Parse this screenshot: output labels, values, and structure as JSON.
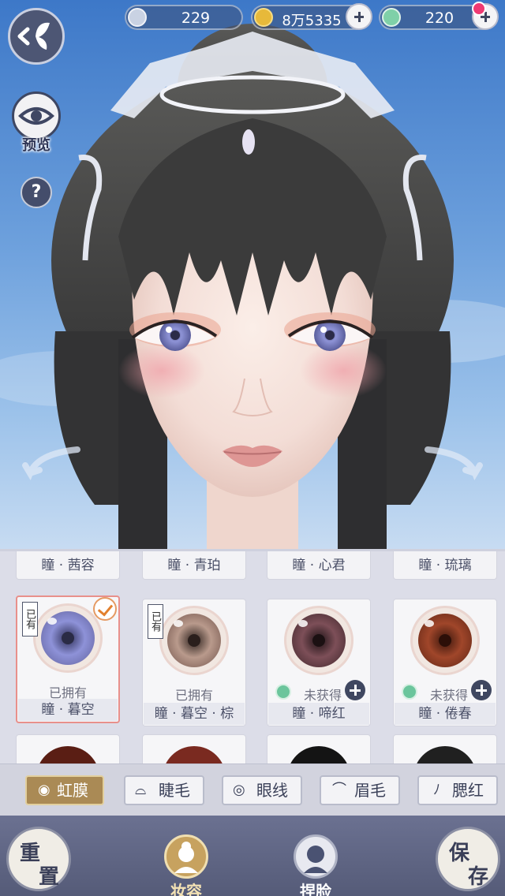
{
  "currency": {
    "silver": "229",
    "coins": "8万5335",
    "jade": "220"
  },
  "left": {
    "preview_label": "预览",
    "help_label": "?"
  },
  "panel": {
    "top_row": [
      "瞳 · 茜容",
      "瞳 · 青珀",
      "瞳 · 心君",
      "瞳 · 琉璃"
    ],
    "items": [
      {
        "name": "瞳 · 暮空",
        "status": "已拥有",
        "owned_tag": "已有",
        "selected": true,
        "locked": false
      },
      {
        "name": "瞳 · 暮空 · 棕",
        "status": "已拥有",
        "owned_tag": "已有",
        "selected": false,
        "locked": false
      },
      {
        "name": "瞳 · 啼红",
        "status": "未获得",
        "owned_tag": "",
        "selected": false,
        "locked": true
      },
      {
        "name": "瞳 · 倦春",
        "status": "未获得",
        "owned_tag": "",
        "selected": false,
        "locked": true
      }
    ]
  },
  "tabs": [
    {
      "label": "虹膜",
      "icon": "iris-icon"
    },
    {
      "label": "睫毛",
      "icon": "eyelash-icon"
    },
    {
      "label": "眼线",
      "icon": "eyeliner-icon"
    },
    {
      "label": "眉毛",
      "icon": "eyebrow-icon"
    },
    {
      "label": "腮红",
      "icon": "blush-icon"
    }
  ],
  "bottom": {
    "reset": [
      "重",
      "置"
    ],
    "makeup": "妆容",
    "face": "捏脸",
    "save": [
      "保",
      "存"
    ]
  },
  "colors": {
    "accent": "#aa8a55",
    "selected_border": "#e8908b",
    "panel_bg": "#dcdde8"
  }
}
